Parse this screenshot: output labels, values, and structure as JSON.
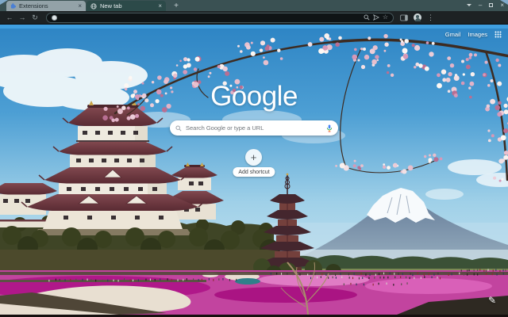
{
  "browser": {
    "tabs": [
      {
        "label": "Extensions",
        "state": "inactive"
      },
      {
        "label": "New tab",
        "state": "active"
      }
    ]
  },
  "page": {
    "links": {
      "gmail": "Gmail",
      "images": "Images"
    },
    "logo_text": "Google",
    "search_placeholder": "Search Google or type a URL",
    "add_shortcut_label": "Add shortcut"
  },
  "icons": {
    "close": "×",
    "plus": "+",
    "back": "←",
    "forward": "→",
    "reload": "↻",
    "star": "☆",
    "kebab": "⋮",
    "minimize": "–",
    "pencil": "✎"
  },
  "theme": {
    "frame": "#3a5153",
    "active_tab": "#2c4a49",
    "toolbar": "#1d2224",
    "sky_blue": "#3f97d4",
    "field_pink": "#c2449f",
    "blossom_pink": "#eccdd8",
    "roof_maroon": "#6b3a41"
  }
}
